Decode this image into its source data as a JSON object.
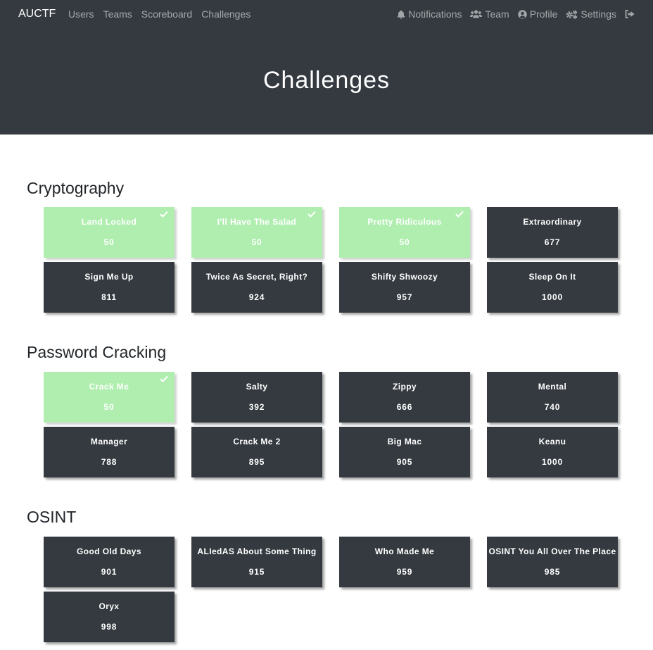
{
  "navbar": {
    "brand": "AUCTF",
    "left_links": [
      {
        "label": "Users"
      },
      {
        "label": "Teams"
      },
      {
        "label": "Scoreboard"
      },
      {
        "label": "Challenges"
      }
    ],
    "right_links": [
      {
        "label": "Notifications",
        "icon": "bell-icon"
      },
      {
        "label": "Team",
        "icon": "users-icon"
      },
      {
        "label": "Profile",
        "icon": "user-circle-icon"
      },
      {
        "label": "Settings",
        "icon": "gears-icon"
      },
      {
        "label": "",
        "icon": "sign-out-icon"
      }
    ]
  },
  "page": {
    "title": "Challenges"
  },
  "colors": {
    "dark": "#343a40",
    "solved": "#b0eeb0"
  },
  "categories": [
    {
      "name": "Cryptography",
      "challenges": [
        {
          "name": "Land Locked",
          "value": "50",
          "solved": true
        },
        {
          "name": "I'll Have The Salad",
          "value": "50",
          "solved": true
        },
        {
          "name": "Pretty Ridiculous",
          "value": "50",
          "solved": true
        },
        {
          "name": "Extraordinary",
          "value": "677",
          "solved": false
        },
        {
          "name": "Sign Me Up",
          "value": "811",
          "solved": false
        },
        {
          "name": "Twice As Secret, Right?",
          "value": "924",
          "solved": false
        },
        {
          "name": "Shifty Shwoozy",
          "value": "957",
          "solved": false
        },
        {
          "name": "Sleep On It",
          "value": "1000",
          "solved": false
        }
      ]
    },
    {
      "name": "Password Cracking",
      "challenges": [
        {
          "name": "Crack Me",
          "value": "50",
          "solved": true
        },
        {
          "name": "Salty",
          "value": "392",
          "solved": false
        },
        {
          "name": "Zippy",
          "value": "666",
          "solved": false
        },
        {
          "name": "Mental",
          "value": "740",
          "solved": false
        },
        {
          "name": "Manager",
          "value": "788",
          "solved": false
        },
        {
          "name": "Crack Me 2",
          "value": "895",
          "solved": false
        },
        {
          "name": "Big Mac",
          "value": "905",
          "solved": false
        },
        {
          "name": "Keanu",
          "value": "1000",
          "solved": false
        }
      ]
    },
    {
      "name": "OSINT",
      "challenges": [
        {
          "name": "Good Old Days",
          "value": "901",
          "solved": false
        },
        {
          "name": "ALIedAS About Some Thing",
          "value": "915",
          "solved": false
        },
        {
          "name": "Who Made Me",
          "value": "959",
          "solved": false
        },
        {
          "name": "OSINT You All Over The Place",
          "value": "985",
          "solved": false
        },
        {
          "name": "Oryx",
          "value": "998",
          "solved": false
        }
      ]
    }
  ]
}
